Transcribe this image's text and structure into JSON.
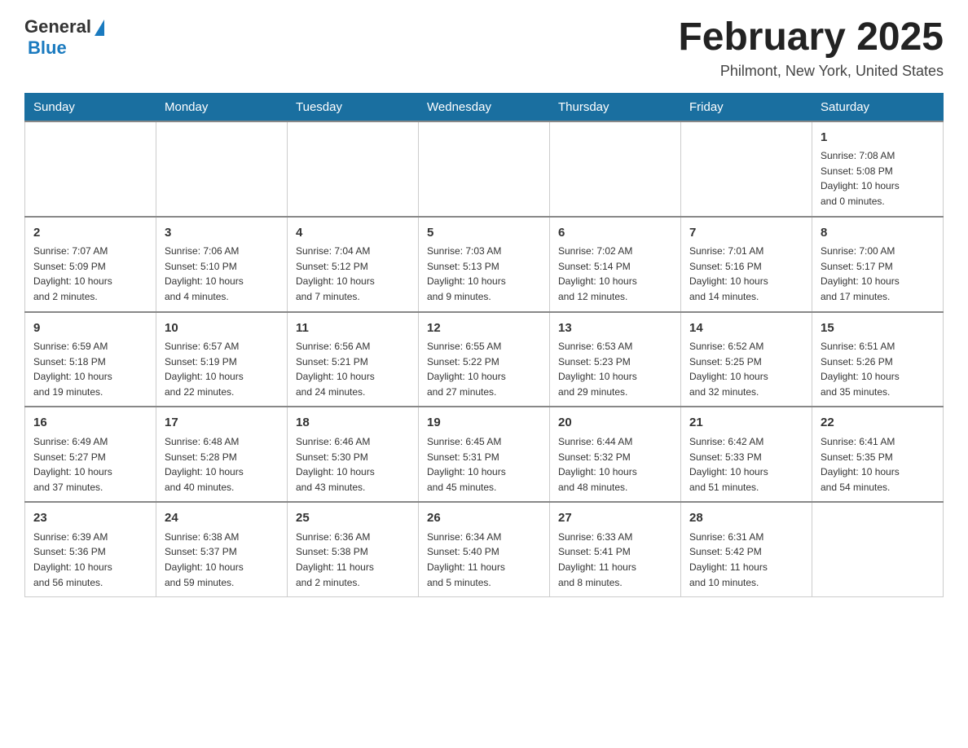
{
  "header": {
    "logo_general": "General",
    "logo_blue": "Blue",
    "month_title": "February 2025",
    "location": "Philmont, New York, United States"
  },
  "days_of_week": [
    "Sunday",
    "Monday",
    "Tuesday",
    "Wednesday",
    "Thursday",
    "Friday",
    "Saturday"
  ],
  "weeks": [
    [
      {
        "day": "",
        "info": ""
      },
      {
        "day": "",
        "info": ""
      },
      {
        "day": "",
        "info": ""
      },
      {
        "day": "",
        "info": ""
      },
      {
        "day": "",
        "info": ""
      },
      {
        "day": "",
        "info": ""
      },
      {
        "day": "1",
        "info": "Sunrise: 7:08 AM\nSunset: 5:08 PM\nDaylight: 10 hours\nand 0 minutes."
      }
    ],
    [
      {
        "day": "2",
        "info": "Sunrise: 7:07 AM\nSunset: 5:09 PM\nDaylight: 10 hours\nand 2 minutes."
      },
      {
        "day": "3",
        "info": "Sunrise: 7:06 AM\nSunset: 5:10 PM\nDaylight: 10 hours\nand 4 minutes."
      },
      {
        "day": "4",
        "info": "Sunrise: 7:04 AM\nSunset: 5:12 PM\nDaylight: 10 hours\nand 7 minutes."
      },
      {
        "day": "5",
        "info": "Sunrise: 7:03 AM\nSunset: 5:13 PM\nDaylight: 10 hours\nand 9 minutes."
      },
      {
        "day": "6",
        "info": "Sunrise: 7:02 AM\nSunset: 5:14 PM\nDaylight: 10 hours\nand 12 minutes."
      },
      {
        "day": "7",
        "info": "Sunrise: 7:01 AM\nSunset: 5:16 PM\nDaylight: 10 hours\nand 14 minutes."
      },
      {
        "day": "8",
        "info": "Sunrise: 7:00 AM\nSunset: 5:17 PM\nDaylight: 10 hours\nand 17 minutes."
      }
    ],
    [
      {
        "day": "9",
        "info": "Sunrise: 6:59 AM\nSunset: 5:18 PM\nDaylight: 10 hours\nand 19 minutes."
      },
      {
        "day": "10",
        "info": "Sunrise: 6:57 AM\nSunset: 5:19 PM\nDaylight: 10 hours\nand 22 minutes."
      },
      {
        "day": "11",
        "info": "Sunrise: 6:56 AM\nSunset: 5:21 PM\nDaylight: 10 hours\nand 24 minutes."
      },
      {
        "day": "12",
        "info": "Sunrise: 6:55 AM\nSunset: 5:22 PM\nDaylight: 10 hours\nand 27 minutes."
      },
      {
        "day": "13",
        "info": "Sunrise: 6:53 AM\nSunset: 5:23 PM\nDaylight: 10 hours\nand 29 minutes."
      },
      {
        "day": "14",
        "info": "Sunrise: 6:52 AM\nSunset: 5:25 PM\nDaylight: 10 hours\nand 32 minutes."
      },
      {
        "day": "15",
        "info": "Sunrise: 6:51 AM\nSunset: 5:26 PM\nDaylight: 10 hours\nand 35 minutes."
      }
    ],
    [
      {
        "day": "16",
        "info": "Sunrise: 6:49 AM\nSunset: 5:27 PM\nDaylight: 10 hours\nand 37 minutes."
      },
      {
        "day": "17",
        "info": "Sunrise: 6:48 AM\nSunset: 5:28 PM\nDaylight: 10 hours\nand 40 minutes."
      },
      {
        "day": "18",
        "info": "Sunrise: 6:46 AM\nSunset: 5:30 PM\nDaylight: 10 hours\nand 43 minutes."
      },
      {
        "day": "19",
        "info": "Sunrise: 6:45 AM\nSunset: 5:31 PM\nDaylight: 10 hours\nand 45 minutes."
      },
      {
        "day": "20",
        "info": "Sunrise: 6:44 AM\nSunset: 5:32 PM\nDaylight: 10 hours\nand 48 minutes."
      },
      {
        "day": "21",
        "info": "Sunrise: 6:42 AM\nSunset: 5:33 PM\nDaylight: 10 hours\nand 51 minutes."
      },
      {
        "day": "22",
        "info": "Sunrise: 6:41 AM\nSunset: 5:35 PM\nDaylight: 10 hours\nand 54 minutes."
      }
    ],
    [
      {
        "day": "23",
        "info": "Sunrise: 6:39 AM\nSunset: 5:36 PM\nDaylight: 10 hours\nand 56 minutes."
      },
      {
        "day": "24",
        "info": "Sunrise: 6:38 AM\nSunset: 5:37 PM\nDaylight: 10 hours\nand 59 minutes."
      },
      {
        "day": "25",
        "info": "Sunrise: 6:36 AM\nSunset: 5:38 PM\nDaylight: 11 hours\nand 2 minutes."
      },
      {
        "day": "26",
        "info": "Sunrise: 6:34 AM\nSunset: 5:40 PM\nDaylight: 11 hours\nand 5 minutes."
      },
      {
        "day": "27",
        "info": "Sunrise: 6:33 AM\nSunset: 5:41 PM\nDaylight: 11 hours\nand 8 minutes."
      },
      {
        "day": "28",
        "info": "Sunrise: 6:31 AM\nSunset: 5:42 PM\nDaylight: 11 hours\nand 10 minutes."
      },
      {
        "day": "",
        "info": ""
      }
    ]
  ]
}
